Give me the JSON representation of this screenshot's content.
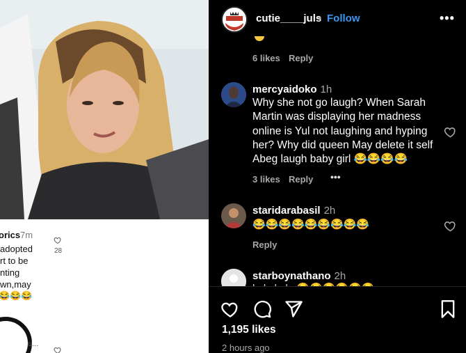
{
  "left_panel": {
    "username_fragment": "orics",
    "time": "7m",
    "lines": [
      "adopted",
      "rt to be",
      "nting",
      "wn,may",
      "😂😂😂"
    ],
    "like_count": "28",
    "truncated_user": "u..."
  },
  "header": {
    "username": "cutie____juls",
    "separator": "•",
    "follow_label": "Follow",
    "more_label": "•••"
  },
  "prev_comment": {
    "likes": "6 likes",
    "reply": "Reply"
  },
  "comments": [
    {
      "username": "mercyaidoko",
      "time": "1h",
      "text": "Why she not go laugh? When Sarah Martin was displaying her madness online is Yul not laughing and hyping her? Why did queen May delete it self Abeg laugh baby girl 😂😂😂😂",
      "likes": "3 likes",
      "reply": "Reply",
      "more": "•••"
    },
    {
      "username": "staridarabasil",
      "time": "2h",
      "text": "😂😂😂😂😂😂😂😂😂",
      "reply": "Reply"
    },
    {
      "username": "starboynathano",
      "time": "2h",
      "text": "l...l...l...l...😂😂😂😂😂😂"
    }
  ],
  "footer": {
    "likes": "1,195 likes",
    "time_ago": "2 hours ago"
  },
  "colors": {
    "accent": "#3897f0",
    "muted": "#a8a8a8",
    "background": "#000000"
  }
}
